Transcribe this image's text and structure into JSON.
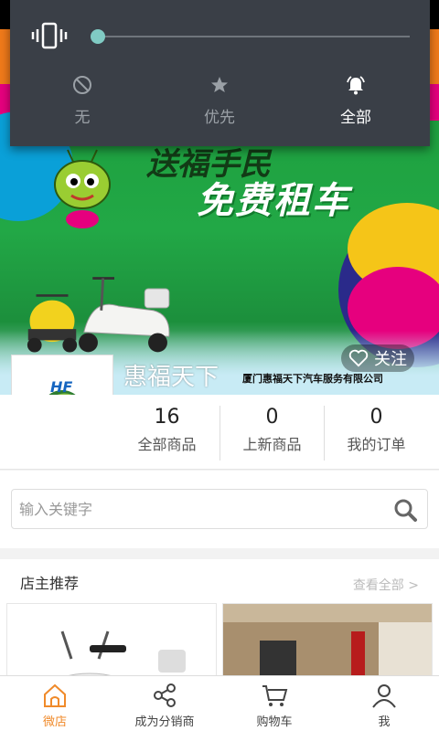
{
  "quick_settings": {
    "options": [
      {
        "label": "无",
        "icon": "do-not-disturb-icon",
        "active": false
      },
      {
        "label": "优先",
        "icon": "star-icon",
        "active": false
      },
      {
        "label": "全部",
        "icon": "bell-icon",
        "active": true
      }
    ],
    "volume_level": 0.0
  },
  "banner": {
    "slogan_top": "送福手民",
    "slogan": "免费租车",
    "shop_name": "惠福天下",
    "company_name": "厦门惠福天下汽车服务有限公司",
    "follow_label": "关注",
    "logo_text": "HF"
  },
  "stats": [
    {
      "value": "16",
      "label": "全部商品"
    },
    {
      "value": "0",
      "label": "上新商品"
    },
    {
      "value": "0",
      "label": "我的订单"
    }
  ],
  "search": {
    "placeholder": "输入关键字",
    "value": ""
  },
  "recommend": {
    "title": "店主推荐",
    "more": "查看全部 >"
  },
  "tabbar": [
    {
      "label": "微店",
      "icon": "home-icon",
      "active": true
    },
    {
      "label": "成为分销商",
      "icon": "share-icon",
      "active": false
    },
    {
      "label": "购物车",
      "icon": "cart-icon",
      "active": false
    },
    {
      "label": "我",
      "icon": "user-icon",
      "active": false
    }
  ],
  "colors": {
    "accent": "#f08a2a",
    "qs_bg": "#3a3f47",
    "slider": "#80cbc4"
  }
}
